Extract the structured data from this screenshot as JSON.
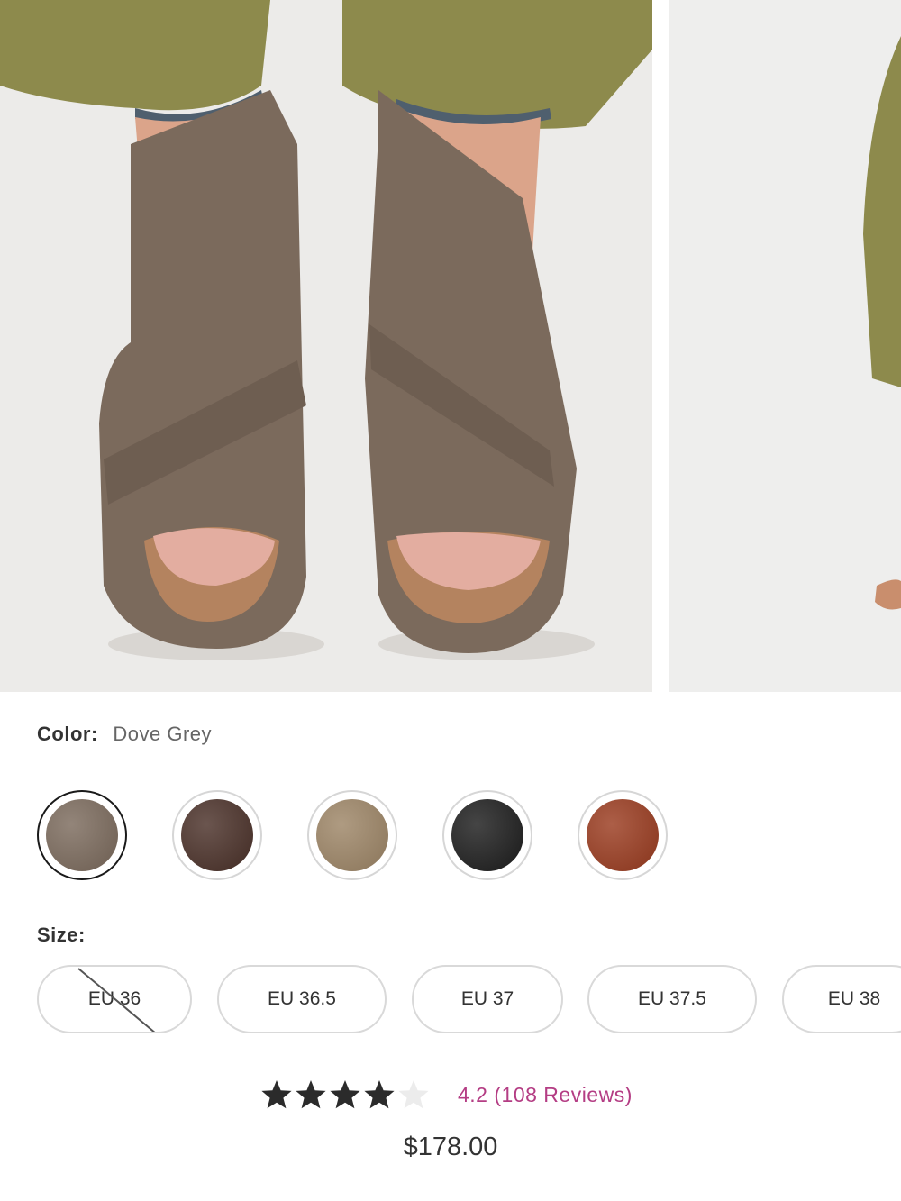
{
  "gallery": {
    "images": [
      {
        "alt": "Dove Grey leather sandals worn with olive trousers"
      },
      {
        "alt": "Next gallery image"
      }
    ]
  },
  "color": {
    "label": "Color:",
    "selected": "Dove Grey",
    "swatches": [
      {
        "name": "dove-grey",
        "color": "#7b6a5c",
        "selected": true
      },
      {
        "name": "dark-brown",
        "color": "#4a3028",
        "selected": false
      },
      {
        "name": "taupe",
        "color": "#9d8566",
        "selected": false
      },
      {
        "name": "black",
        "color": "#1c1c1c",
        "selected": false
      },
      {
        "name": "cognac",
        "color": "#9a3b1f",
        "selected": false
      }
    ]
  },
  "size": {
    "label": "Size:",
    "options": [
      {
        "label": "EU 36",
        "available": false
      },
      {
        "label": "EU 36.5",
        "available": true
      },
      {
        "label": "EU 37",
        "available": true
      },
      {
        "label": "EU 37.5",
        "available": true
      },
      {
        "label": "EU 38",
        "available": true
      }
    ]
  },
  "rating": {
    "stars_filled": 4,
    "stars_total": 5,
    "text": "4.2 (108 Reviews)",
    "accent": "#b43d84"
  },
  "price": "$178.00"
}
